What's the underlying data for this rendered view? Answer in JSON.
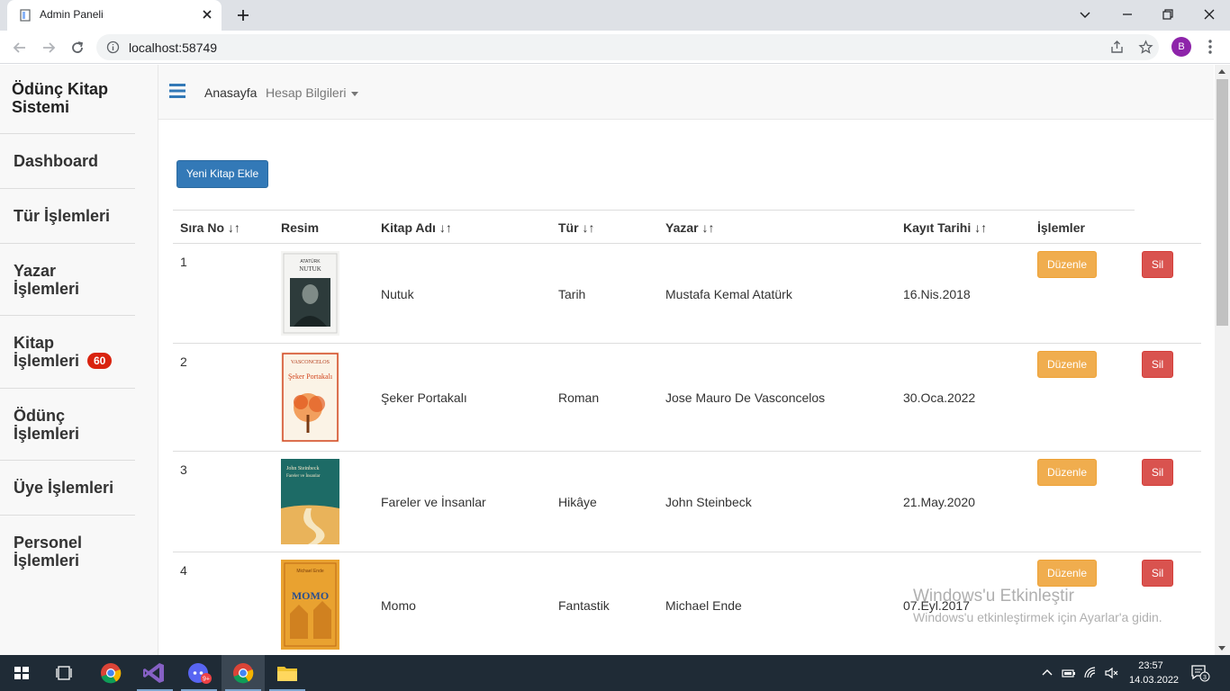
{
  "browser": {
    "tab_title": "Admin Paneli",
    "url": "localhost:58749",
    "profile_initial": "B"
  },
  "sidebar": {
    "brand": "Ödünç Kitap Sistemi",
    "items": [
      {
        "label": "Dashboard"
      },
      {
        "label": "Tür İşlemleri"
      },
      {
        "label": "Yazar İşlemleri"
      },
      {
        "label": "Kitap İşlemleri",
        "badge": "60"
      },
      {
        "label": "Ödünç İşlemleri"
      },
      {
        "label": "Üye İşlemleri"
      },
      {
        "label": "Personel İşlemleri"
      }
    ]
  },
  "topnav": {
    "home": "Anasayfa",
    "account": "Hesap Bilgileri"
  },
  "main": {
    "add_button": "Yeni Kitap Ekle",
    "columns": [
      {
        "label": "Sıra No",
        "sortable": true
      },
      {
        "label": "Resim",
        "sortable": false
      },
      {
        "label": "Kitap Adı",
        "sortable": true
      },
      {
        "label": "Tür",
        "sortable": true
      },
      {
        "label": "Yazar",
        "sortable": true
      },
      {
        "label": "Kayıt Tarihi",
        "sortable": true
      },
      {
        "label": "İşlemler",
        "sortable": false
      }
    ],
    "sort_glyph": "↓↑",
    "edit_label": "Düzenle",
    "delete_label": "Sil",
    "rows": [
      {
        "no": "1",
        "title": "Nutuk",
        "genre": "Tarih",
        "author": "Mustafa Kemal Atatürk",
        "date": "16.Nis.2018",
        "cover": {
          "bg": "#f4f4f2",
          "accent": "#3a3a3a",
          "top_text": "ATATÜRK",
          "main_text": "NUTUK"
        }
      },
      {
        "no": "2",
        "title": "Şeker Portakalı",
        "genre": "Roman",
        "author": "Jose Mauro De Vasconcelos",
        "date": "30.Oca.2022",
        "cover": {
          "bg": "#fbf3e6",
          "accent": "#d2451e",
          "top_text": "VASCONCELOS",
          "main_text": "Şeker Portakalı"
        }
      },
      {
        "no": "3",
        "title": "Fareler ve İnsanlar",
        "genre": "Hikâye",
        "author": "John Steinbeck",
        "date": "21.May.2020",
        "cover": {
          "bg": "#1d6b66",
          "accent": "#e9b35a",
          "top_text": "John Steinbeck",
          "main_text": "Fareler ve İnsanlar"
        }
      },
      {
        "no": "4",
        "title": "Momo",
        "genre": "Fantastik",
        "author": "Michael Ende",
        "date": "07.Eyl.2017",
        "cover": {
          "bg": "#e9a230",
          "accent": "#c06a16",
          "top_text": "Michael Ende",
          "main_text": "MOMO"
        }
      }
    ]
  },
  "watermark": {
    "line1": "Windows'u Etkinleştir",
    "line2": "Windows'u etkinleştirmek için Ayarlar'a gidin."
  },
  "taskbar": {
    "time": "23:57",
    "date": "14.03.2022",
    "notification_count": "3",
    "discord_badge": "9+"
  }
}
